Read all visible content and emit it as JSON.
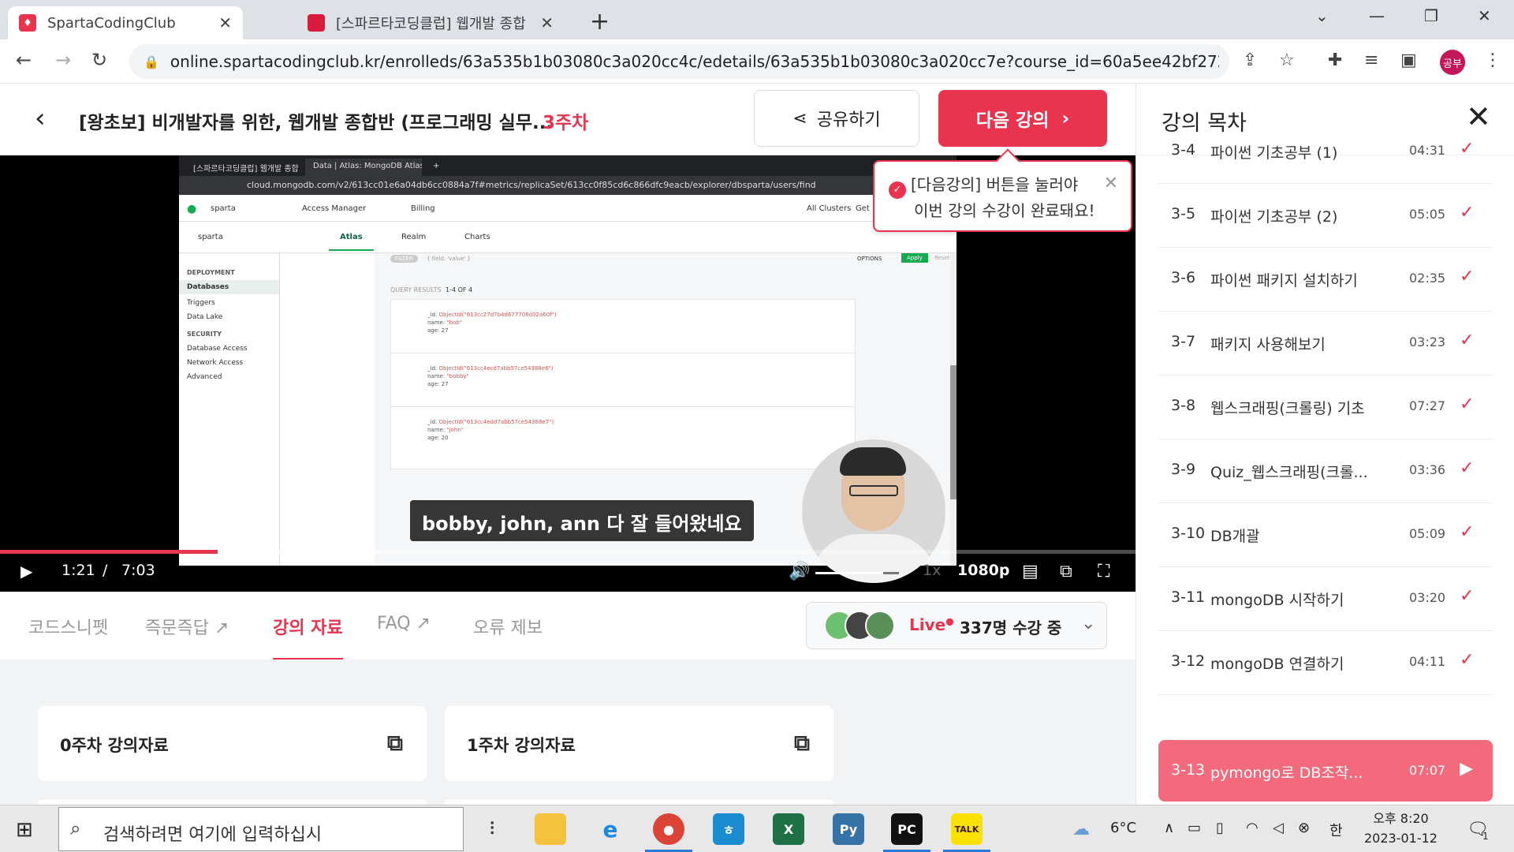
{
  "browser": {
    "tabs": [
      {
        "title": "SpartaCodingClub",
        "favicon": "sparta-logo-icon",
        "active": true
      },
      {
        "title": "[스파르타코딩클럽] 웹개발 종합",
        "favicon": "sparta-book-icon",
        "active": false
      }
    ],
    "url": "online.spartacodingclub.kr/enrolleds/63a535b1b03080c3a020cc4c/edetails/63a535b1b03080c3a020cc7e?course_id=60a5ee42bf272bef32a5...",
    "profile_label": "공부"
  },
  "header": {
    "course_title": "[왕초보] 비개발자를 위한, 웹개발 종합반 (프로그래밍 실무...",
    "week": "3주차",
    "share_label": "공유하기",
    "next_label": "다음 강의"
  },
  "tooltip": {
    "highlight": "[다음강의]",
    "line1": " 버튼을 눌러야",
    "line2": "이번 강의 수강이 완료돼요!"
  },
  "video": {
    "subtitle": "bobby, john, ann 다 잘 들어왔네요",
    "current_time": "1:21",
    "separator": "/",
    "duration": "7:03",
    "progress": 0.192,
    "buffered": 0.335,
    "speed": "1x",
    "quality": "1080p",
    "screen": {
      "tab1": "[스파르타코딩클럽] 웹개발 종합",
      "tab2": "Data | Atlas: MongoDB Atlas",
      "url": "cloud.mongodb.com/v2/613cc01e6a04db6cc0884a7f#metrics/replicaSet/613cc0f85cd6c866dfc9eacb/explorer/dbsparta/users/find",
      "org": "sparta",
      "access_manager": "Access Manager",
      "billing": "Billing",
      "all_clusters": "All Clusters",
      "get_help": "Get H",
      "project": "sparta",
      "nav_atlas": "Atlas",
      "nav_realm": "Realm",
      "nav_charts": "Charts",
      "side_deployment": "DEPLOYMENT",
      "side_databases": "Databases",
      "side_triggers": "Triggers",
      "side_datalake": "Data Lake",
      "side_security": "SECURITY",
      "side_dbaccess": "Database Access",
      "side_netaccess": "Network Access",
      "side_advanced": "Advanced",
      "filter_label": "FILTER",
      "filter_value": "{ field: 'value' }",
      "options": "OPTIONS",
      "apply": "Apply",
      "reset": "Reset",
      "query_results": "QUERY RESULTS",
      "query_range": "1-4 OF 4",
      "docs": [
        {
          "id": "ObjectId(\"613cc27d7b4d677708d02a60f\")",
          "name": "\"bob\"",
          "age": "27"
        },
        {
          "id": "ObjectId(\"613cc4ecd7abb57ce54388e6\")",
          "name": "\"bobby\"",
          "age": "27"
        },
        {
          "id": "ObjectId(\"613cc4edd7abb57ce54388e7\")",
          "name": "\"john\"",
          "age": "20"
        }
      ],
      "field_id": "_id:",
      "field_name": "name:",
      "field_age": "age:"
    }
  },
  "lecture_tabs": [
    {
      "label": "코드스니펫",
      "active": false,
      "external": false
    },
    {
      "label": "즉문즉답",
      "active": false,
      "external": true
    },
    {
      "label": "강의 자료",
      "active": true,
      "external": false
    },
    {
      "label": "FAQ",
      "active": false,
      "external": true
    },
    {
      "label": "오류 제보",
      "active": false,
      "external": false
    }
  ],
  "live": {
    "label": "Live",
    "count_text": "337명 수강 중"
  },
  "materials": [
    {
      "label": "0주차 강의자료"
    },
    {
      "label": "1주차 강의자료"
    }
  ],
  "toc": {
    "title": "강의 목차",
    "items": [
      {
        "num": "3-4",
        "title": "파이썬 기초공부 (1)",
        "duration": "04:31",
        "done": true
      },
      {
        "num": "3-5",
        "title": "파이썬 기초공부 (2)",
        "duration": "05:05",
        "done": true
      },
      {
        "num": "3-6",
        "title": "파이썬 패키지 설치하기",
        "duration": "02:35",
        "done": true
      },
      {
        "num": "3-7",
        "title": "패키지 사용해보기",
        "duration": "03:23",
        "done": true
      },
      {
        "num": "3-8",
        "title": "웹스크래핑(크롤링) 기초",
        "duration": "07:27",
        "done": true
      },
      {
        "num": "3-9",
        "title": "Quiz_웹스크래핑(크롤...",
        "duration": "03:36",
        "done": true
      },
      {
        "num": "3-10",
        "title": "DB개괄",
        "duration": "05:09",
        "done": true
      },
      {
        "num": "3-11",
        "title": "mongoDB 시작하기",
        "duration": "03:20",
        "done": true
      },
      {
        "num": "3-12",
        "title": "mongoDB 연결하기",
        "duration": "04:11",
        "done": true
      },
      {
        "num": "3-13",
        "title": "pymongo로 DB조작...",
        "duration": "07:07",
        "current": true
      }
    ]
  },
  "taskbar": {
    "search_placeholder": "검색하려면 여기에 입력하십시",
    "weather": "6°C",
    "ime": "한",
    "time": "오후 8:20",
    "date": "2023-01-12",
    "notifications": "1",
    "apps": [
      "task-view-icon",
      "file-explorer-icon",
      "internet-explorer-icon",
      "chrome-icon",
      "hwp-icon",
      "excel-icon",
      "python-icon",
      "pycharm-icon",
      "kakaotalk-icon"
    ]
  },
  "colors": {
    "accent": "#e8344e",
    "current_item": "#f36a7c"
  }
}
